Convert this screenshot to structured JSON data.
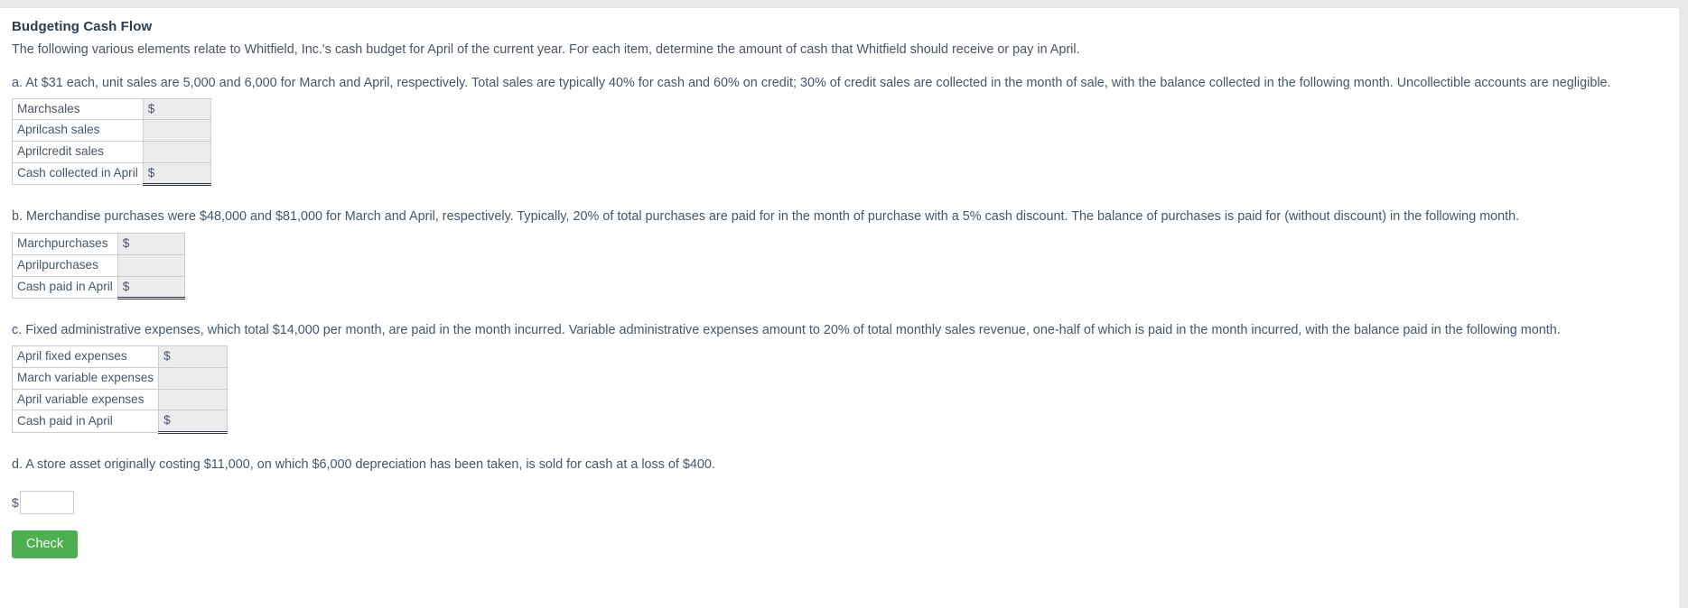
{
  "header": {
    "title": "Budgeting Cash Flow",
    "intro": "The following various elements relate to Whitfield, Inc.'s cash budget for April of the current year. For each item, determine the amount of cash that Whitfield should receive or pay in April."
  },
  "items": {
    "a": {
      "text": "a. At $31 each, unit sales are 5,000 and 6,000 for March and April, respectively. Total sales are typically 40% for cash and 60% on credit; 30% of credit sales are collected in the month of sale, with the balance collected in the following month. Uncollectible accounts are negligible.",
      "table": {
        "rows": [
          {
            "label": "Marchsales",
            "value": "$",
            "total": false
          },
          {
            "label": "Aprilcash sales",
            "value": "",
            "total": false
          },
          {
            "label": "Aprilcredit sales",
            "value": "",
            "total": false
          },
          {
            "label": "Cash collected in April",
            "value": "$",
            "total": true
          }
        ]
      }
    },
    "b": {
      "text": "b. Merchandise purchases were $48,000 and $81,000 for March and April, respectively. Typically, 20% of total purchases are paid for in the month of purchase with a 5% cash discount. The balance of purchases is paid for (without discount) in the following month.",
      "table": {
        "rows": [
          {
            "label": "Marchpurchases",
            "value": "$",
            "total": false
          },
          {
            "label": "Aprilpurchases",
            "value": "",
            "total": false
          },
          {
            "label": "Cash paid in April",
            "value": "$",
            "total": true
          }
        ]
      }
    },
    "c": {
      "text": "c. Fixed administrative expenses, which total $14,000 per month, are paid in the month incurred. Variable administrative expenses amount to 20% of total monthly sales revenue, one-half of which is paid in the month incurred, with the balance paid in the following month.",
      "table": {
        "rows": [
          {
            "label": "April fixed expenses",
            "value": "$",
            "total": false
          },
          {
            "label": "March variable expenses",
            "value": "",
            "total": false
          },
          {
            "label": "April variable expenses",
            "value": "",
            "total": false
          },
          {
            "label": "Cash paid in April",
            "value": "$",
            "total": true
          }
        ]
      }
    },
    "d": {
      "text": "d. A store asset originally costing $11,000, on which $6,000 depreciation has been taken, is sold for cash at a loss of $400.",
      "currency_symbol": "$",
      "input_value": "",
      "input_placeholder": ""
    }
  },
  "footer": {
    "check_label": "Check",
    "check_color": "#4caf50"
  }
}
